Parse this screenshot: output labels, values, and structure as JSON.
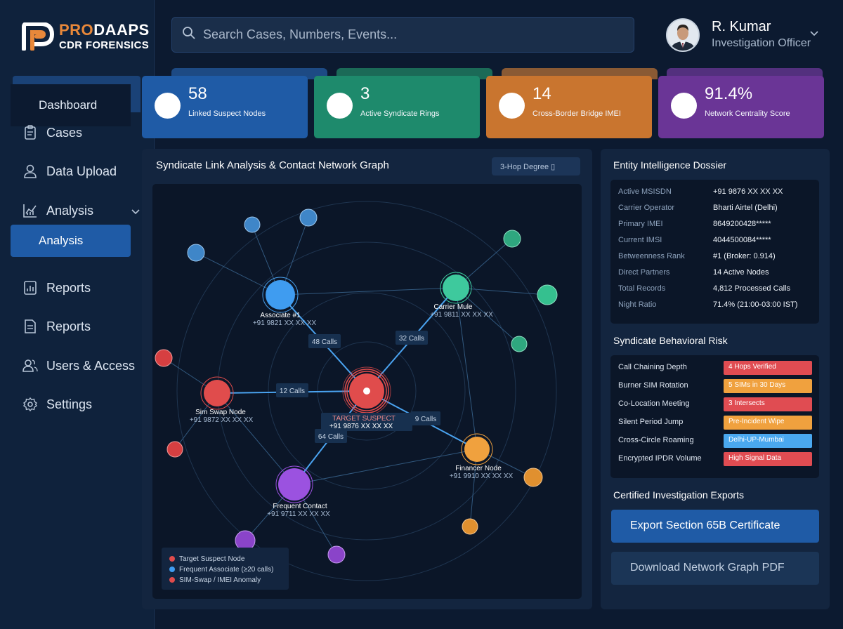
{
  "brand": {
    "name_part1": "PRO",
    "name_part2": "DAAPS",
    "subtitle": "CDR FORENSICS",
    "accent_color": "#e8883a"
  },
  "sidebar": {
    "dashboard_label": "Dashboard",
    "items": [
      {
        "label": "Cases",
        "icon": "clipboard-icon"
      },
      {
        "label": "Data Upload",
        "icon": "user-icon"
      },
      {
        "label": "Analysis",
        "icon": "chart-line-icon"
      },
      {
        "label": "Reports",
        "icon": "report-chart-icon"
      },
      {
        "label": "Reports",
        "icon": "document-icon"
      },
      {
        "label": "Users & Access",
        "icon": "users-icon"
      },
      {
        "label": "Settings",
        "icon": "gear-icon"
      }
    ],
    "active_submenu_label": "Analysis"
  },
  "search": {
    "placeholder": "Search Cases, Numbers, Events..."
  },
  "user": {
    "name": "R. Kumar",
    "role": "Investigation Officer"
  },
  "stats": [
    {
      "value": "58",
      "label": "Linked Suspect Nodes",
      "color": "#1f5ba6"
    },
    {
      "value": "3",
      "label": "Active Syndicate Rings",
      "color": "#1e8a6c"
    },
    {
      "value": "14",
      "label": "Cross-Border Bridge IMEI",
      "color": "#c9752f"
    },
    {
      "value": "91.4%",
      "label": "Network Centrality Score",
      "color": "#6a3596"
    }
  ],
  "graph": {
    "title": "Syndicate Link Analysis & Contact Network Graph",
    "hop_button": "3-Hop Degree ▯",
    "nodes": {
      "target": {
        "name": "TARGET SUSPECT",
        "number": "+91 9876 XX XX XX"
      },
      "associate": {
        "name": "Associate #1",
        "number": "+91 9821 XX XX XX"
      },
      "carrier": {
        "name": "Carrier Mule",
        "number": "+91 9811 XX XX XX"
      },
      "simswap": {
        "name": "Sim Swap Node",
        "number": "+91 9872 XX XX XX"
      },
      "financer": {
        "name": "Financer Node",
        "number": "+91 9910 XX XX XX"
      },
      "frequent": {
        "name": "Frequent Contact",
        "number": "+91 9711 XX XX XX"
      }
    },
    "edge_labels": {
      "associate": "48 Calls",
      "carrier": "32 Calls",
      "simswap": "12 Calls",
      "financer": "9 Calls",
      "frequent": "64 Calls"
    },
    "legend": [
      "Target Suspect Node",
      "Frequent Associate (≥20 calls)",
      "SIM-Swap / IMEI Anomaly"
    ],
    "colors": {
      "red": "#e04c4c",
      "blue": "#3f9cf0",
      "green": "#3ec99d",
      "orange": "#f0a13e",
      "purple": "#9b52e0"
    }
  },
  "dossier": {
    "title": "Entity Intelligence Dossier",
    "rows": [
      {
        "key": "Active MSISDN",
        "value": "+91 9876 XX XX XX"
      },
      {
        "key": "Carrier Operator",
        "value": "Bharti Airtel (Delhi)"
      },
      {
        "key": "Primary IMEI",
        "value": "8649200428*****"
      },
      {
        "key": "Current IMSI",
        "value": "4044500084*****"
      },
      {
        "key": "Betweenness Rank",
        "value": "#1 (Broker: 0.914)"
      },
      {
        "key": "Direct Partners",
        "value": "14 Active Nodes"
      },
      {
        "key": "Total Records",
        "value": "4,812 Processed Calls"
      },
      {
        "key": "Night Ratio",
        "value": "71.4% (21:00-03:00 IST)"
      }
    ]
  },
  "risk": {
    "title": "Syndicate Behavioral Risk",
    "rows": [
      {
        "key": "Call Chaining Depth",
        "badge": "4 Hops Verified",
        "color": "#e04c52"
      },
      {
        "key": "Burner SIM Rotation",
        "badge": "5 SIMs in 30 Days",
        "color": "#f0a13e"
      },
      {
        "key": "Co-Location Meeting",
        "badge": "3 Intersects",
        "color": "#e04c52"
      },
      {
        "key": "Silent Period Jump",
        "badge": "Pre-Incident Wipe",
        "color": "#f0a13e"
      },
      {
        "key": "Cross-Circle Roaming",
        "badge": "Delhi-UP-Mumbai",
        "color": "#4aa8ef"
      },
      {
        "key": "Encrypted IPDR Volume",
        "badge": "High Signal Data",
        "color": "#e04c52"
      }
    ]
  },
  "exports": {
    "title": "Certified Investigation Exports",
    "primary_label": "Export Section 65B Certificate",
    "secondary_label": "Download Network Graph PDF"
  }
}
